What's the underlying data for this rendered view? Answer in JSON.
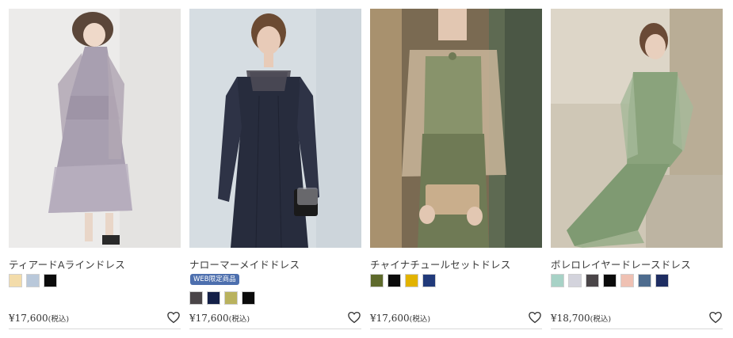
{
  "products": [
    {
      "name": "ティアードAラインドレス",
      "badge": "",
      "colors": [
        "#f3dcaa",
        "#b9c8da",
        "#0b0b0b"
      ],
      "price": "¥17,600",
      "tax": "(税込)",
      "image": "dress-photo-tiered-lavender"
    },
    {
      "name": "ナローマーメイドドレス",
      "badge": "WEB限定商品",
      "colors": [
        "#4a4548",
        "#142048",
        "#b9b25e",
        "#0b0b0b"
      ],
      "price": "¥17,600",
      "tax": "(税込)",
      "image": "dress-photo-navy-mermaid"
    },
    {
      "name": "チャイナチュールセットドレス",
      "badge": "",
      "colors": [
        "#5e6a2c",
        "#0b0b0b",
        "#e2b300",
        "#213a7a"
      ],
      "price": "¥17,600",
      "tax": "(税込)",
      "image": "dress-photo-green-tulle"
    },
    {
      "name": "ボレロレイヤードレースドレス",
      "badge": "",
      "colors": [
        "#a7d2c6",
        "#d3d3dc",
        "#4a4548",
        "#0b0b0b",
        "#efc1b3",
        "#4e6c8e",
        "#1e2d62"
      ],
      "price": "¥18,700",
      "tax": "(税込)",
      "image": "dress-photo-green-lace"
    }
  ],
  "favorite_icon": "heart-outline-icon"
}
